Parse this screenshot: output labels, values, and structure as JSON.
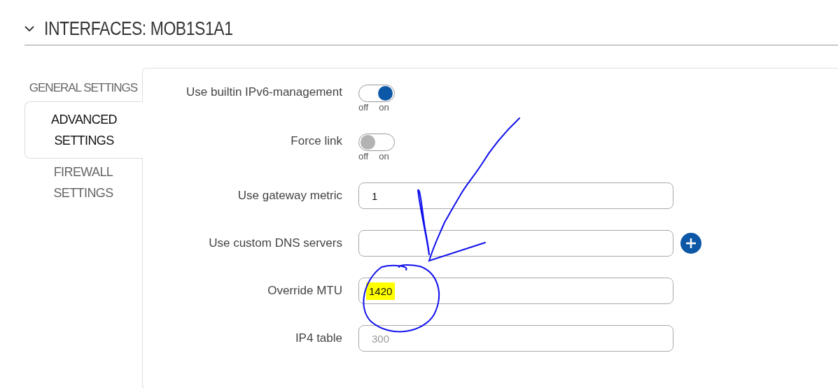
{
  "section": {
    "title": "INTERFACES: MOB1S1A1",
    "expanded": true
  },
  "tabs": [
    {
      "label": "GENERAL SETTINGS",
      "selected": false
    },
    {
      "label": "ADVANCED SETTINGS",
      "selected": true
    },
    {
      "label": "FIREWALL SETTINGS",
      "selected": false
    }
  ],
  "fields": [
    {
      "label": "Use builtin IPv6-management",
      "kind": "toggle",
      "on": true,
      "off_text": "off",
      "on_text": "on"
    },
    {
      "label": "Force link",
      "kind": "toggle",
      "on": false,
      "off_text": "off",
      "on_text": "on"
    },
    {
      "label": "Use gateway metric",
      "kind": "input",
      "value": "1"
    },
    {
      "label": "Use custom DNS servers",
      "kind": "input_add"
    },
    {
      "label": "Override MTU",
      "kind": "input",
      "value": "1420",
      "highlighted": true
    },
    {
      "label": "IP4 table",
      "kind": "input",
      "placeholder": "300"
    }
  ]
}
